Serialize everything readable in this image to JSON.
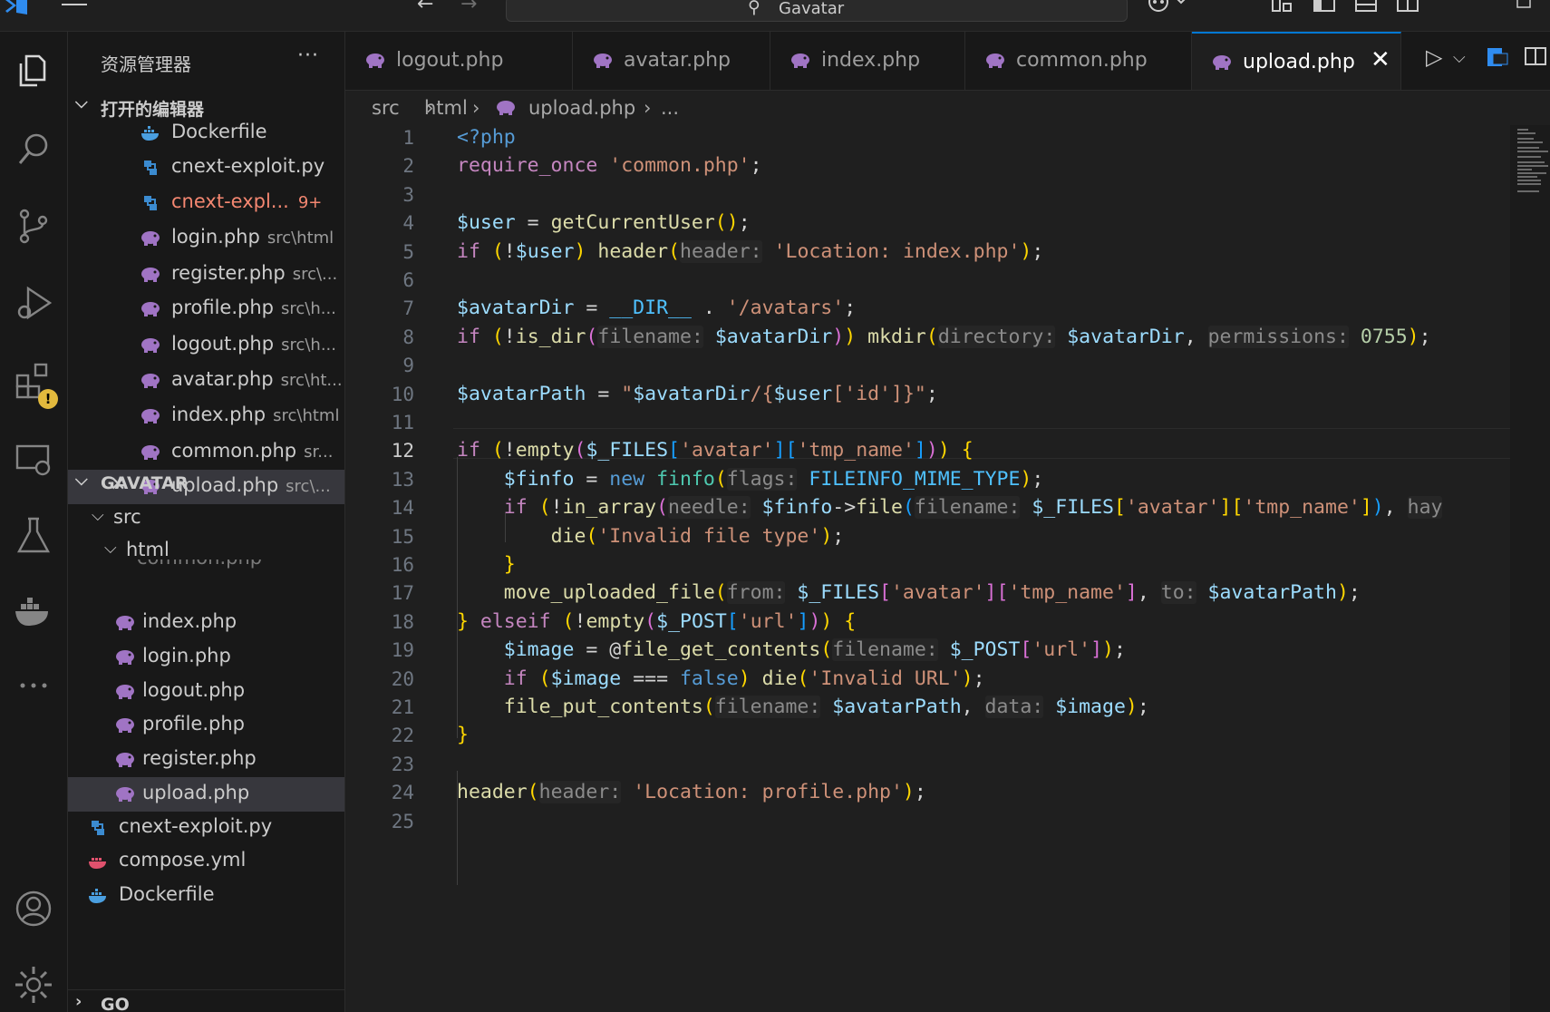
{
  "titlebar": {
    "search_text": "Gavatar",
    "icons": [
      "vscode-logo-icon",
      "menu-icon",
      "back-arrow-icon",
      "forward-arrow-icon",
      "search-icon",
      "copilot-icon",
      "layout-icon",
      "toggle-sidebar-icon",
      "toggle-panel-icon",
      "toggle-secondary-sidebar-icon",
      "minimize-icon",
      "maximize-icon"
    ]
  },
  "activity_bar": {
    "items": [
      "explorer-icon",
      "search-icon",
      "source-control-icon",
      "run-debug-icon",
      "extensions-icon",
      "remote-explorer-icon",
      "testing-icon",
      "docker-icon",
      "more-icon",
      "accounts-icon",
      "settings-gear-icon"
    ],
    "extensions_badge": "!"
  },
  "sidebar": {
    "title": "资源管理器",
    "more": "···",
    "open_editors": {
      "header": "打开的编辑器",
      "items": [
        {
          "name": "Dockerfile",
          "path": "",
          "icon": "docker-icon"
        },
        {
          "name": "cnext-exploit.py",
          "path": "",
          "icon": "python-icon"
        },
        {
          "name": "cnext-expl...",
          "path": "",
          "badge": "9+",
          "icon": "python-icon"
        },
        {
          "name": "login.php",
          "path": "src\\html",
          "icon": "php-icon"
        },
        {
          "name": "register.php",
          "path": "src\\...",
          "icon": "php-icon"
        },
        {
          "name": "profile.php",
          "path": "src\\h...",
          "icon": "php-icon"
        },
        {
          "name": "logout.php",
          "path": "src\\h...",
          "icon": "php-icon"
        },
        {
          "name": "avatar.php",
          "path": "src\\ht...",
          "icon": "php-icon"
        },
        {
          "name": "index.php",
          "path": "src\\html",
          "icon": "php-icon"
        },
        {
          "name": "common.php",
          "path": "sr...",
          "icon": "php-icon"
        },
        {
          "name": "upload.php",
          "path": "src\\...",
          "icon": "php-icon",
          "close": "✕"
        }
      ]
    },
    "workspace": {
      "header": "GAVATAR",
      "folders": [
        "src",
        "html"
      ],
      "partial_file": "common.php",
      "html_files": [
        "index.php",
        "login.php",
        "logout.php",
        "profile.php",
        "register.php",
        "upload.php"
      ],
      "root_files": [
        {
          "name": "cnext-exploit.py",
          "icon": "python-icon"
        },
        {
          "name": "compose.yml",
          "icon": "docker-compose-icon"
        },
        {
          "name": "Dockerfile",
          "icon": "docker-icon"
        }
      ]
    },
    "go_section": "GO"
  },
  "tabs": [
    {
      "label": "logout.php",
      "active": false
    },
    {
      "label": "avatar.php",
      "active": false
    },
    {
      "label": "index.php",
      "active": false
    },
    {
      "label": "common.php",
      "active": false
    },
    {
      "label": "upload.php",
      "active": true
    }
  ],
  "tab_close": "✕",
  "breadcrumb": [
    "src",
    "html",
    "upload.php",
    "..."
  ],
  "editor": {
    "current_line": 12,
    "line_numbers": [
      "1",
      "2",
      "3",
      "4",
      "5",
      "6",
      "7",
      "8",
      "9",
      "10",
      "11",
      "12",
      "13",
      "14",
      "15",
      "16",
      "17",
      "18",
      "19",
      "20",
      "21",
      "22",
      "23",
      "24",
      "25"
    ],
    "lines": [
      "<?php",
      "require_once 'common.php';",
      "",
      "$user = getCurrentUser();",
      "if (!$user) header(header: 'Location: index.php');",
      "",
      "$avatarDir = __DIR__ . '/avatars';",
      "if (!is_dir(filename: $avatarDir)) mkdir(directory: $avatarDir, permissions: 0755);",
      "",
      "$avatarPath = \"$avatarDir/{$user['id']}\";",
      "",
      "if (!empty($_FILES['avatar']['tmp_name'])) {",
      "    $finfo = new finfo(flags: FILEINFO_MIME_TYPE);",
      "    if (!in_array(needle: $finfo->file(filename: $_FILES['avatar']['tmp_name']), hay",
      "        die('Invalid file type');",
      "    }",
      "    move_uploaded_file(from: $_FILES['avatar']['tmp_name'], to: $avatarPath);",
      "} elseif (!empty($_POST['url'])) {",
      "    $image = @file_get_contents(filename: $_POST['url']);",
      "    if ($image === false) die('Invalid URL');",
      "    file_put_contents(filename: $avatarPath, data: $image);",
      "}",
      "",
      "header(header: 'Location: profile.php');",
      ""
    ]
  }
}
